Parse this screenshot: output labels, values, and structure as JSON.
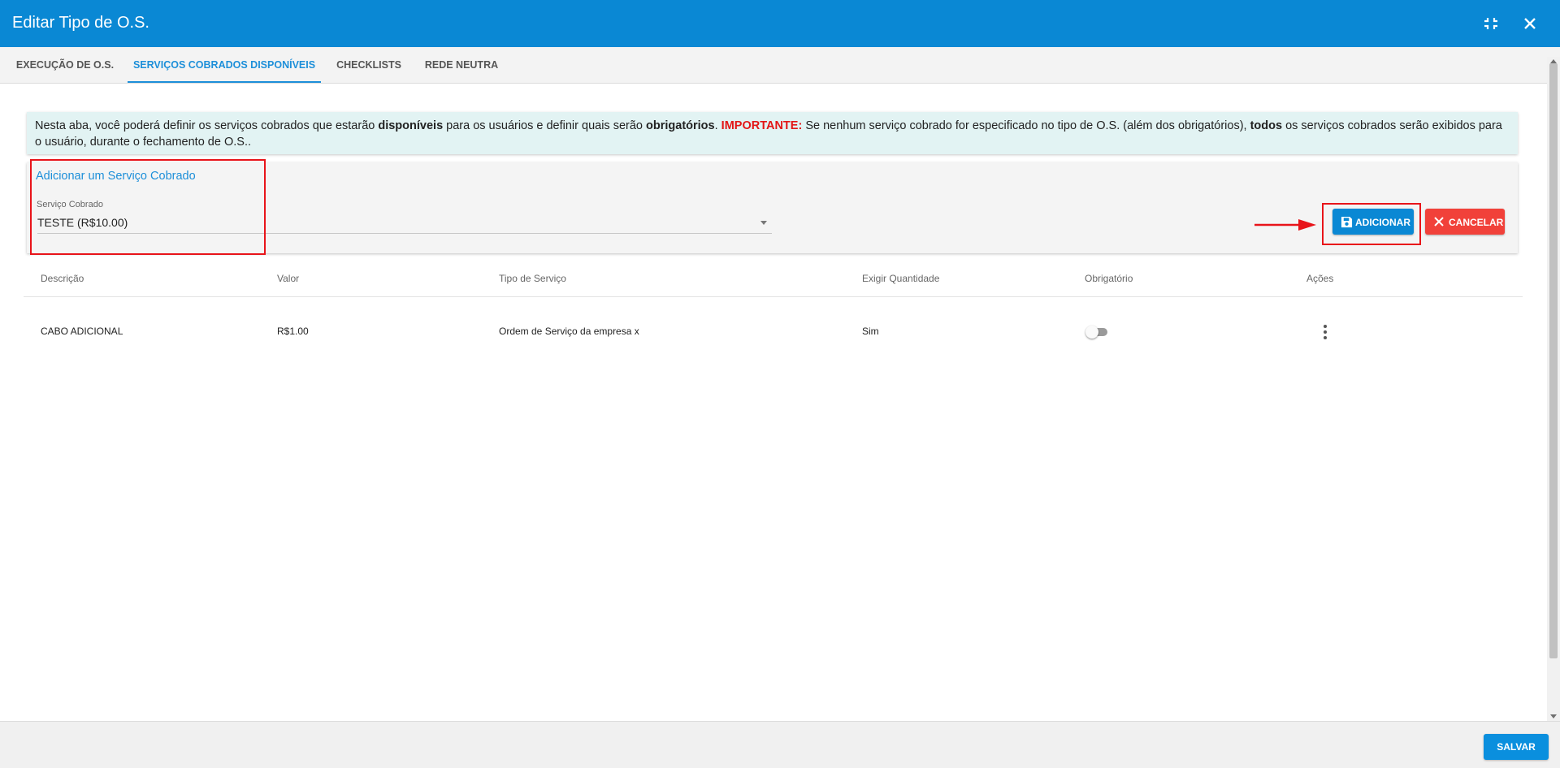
{
  "window": {
    "title": "Editar Tipo de O.S."
  },
  "icons": {
    "compress": "compress-icon",
    "close": "close-icon",
    "save": "floppy-disk-icon",
    "cancel": "x-icon",
    "menu": "more-vert-icon"
  },
  "tabs": [
    {
      "label": "EXECUÇÃO DE O.S."
    },
    {
      "label": "SERVIÇOS COBRADOS DISPONÍVEIS",
      "active": true
    },
    {
      "label": "CHECKLISTS"
    },
    {
      "label": "REDE NEUTRA"
    }
  ],
  "info": {
    "t1": "Nesta aba, você poderá definir os serviços cobrados que estarão ",
    "b1": "disponíveis",
    "t2": " para os usuários e definir quais serão ",
    "b2": "obrigatórios",
    "t3": ". ",
    "important": "IMPORTANTE:",
    "t4": " Se nenhum serviço cobrado for especificado no tipo de O.S. (além dos obrigatórios), ",
    "b3": "todos",
    "t5": " os serviços cobrados serão exibidos para o usuário, durante o fechamento de O.S.."
  },
  "add_panel": {
    "title": "Adicionar um Serviço Cobrado",
    "field_label": "Serviço Cobrado",
    "field_value": "TESTE (R$10.00)",
    "add_label": "ADICIONAR",
    "cancel_label": "CANCELAR"
  },
  "table": {
    "headers": [
      "Descrição",
      "Valor",
      "Tipo de Serviço",
      "Exigir Quantidade",
      "Obrigatório",
      "Ações"
    ],
    "rows": [
      {
        "descricao": "CABO ADICIONAL",
        "valor": "R$1.00",
        "tipo": "Ordem de Serviço da empresa x",
        "exigir": "Sim",
        "obrigatorio": false
      }
    ]
  },
  "footer": {
    "save_label": "SALVAR"
  },
  "colors": {
    "primary": "#0a88d4",
    "danger": "#f1413a",
    "annotation": "#e8141a",
    "info_bg": "#e2f3f3"
  }
}
